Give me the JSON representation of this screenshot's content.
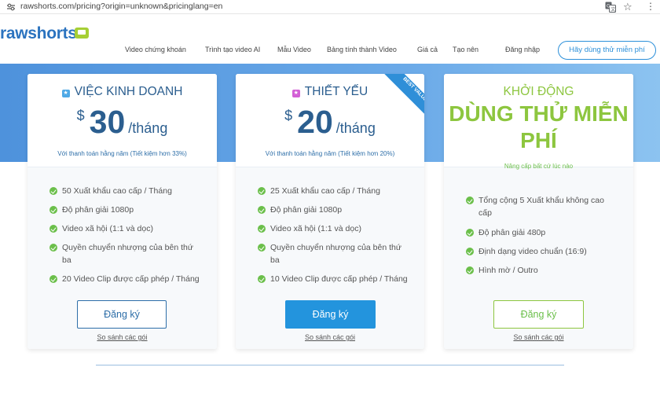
{
  "browser": {
    "url": "rawshorts.com/pricing?origin=unknown&pricinglang=en"
  },
  "nav": {
    "logo": "rawshorts",
    "links": [
      "Video chứng khoán",
      "Trình tạo video AI",
      "Mẫu Video",
      "Bảng tính thành Video",
      "Giá cả",
      "Tạo nên",
      "Đăng nhập"
    ],
    "cta": "Hãy dùng thử miễn phí"
  },
  "plans": [
    {
      "name": "VIỆC KINH DOANH",
      "currency": "$",
      "amount": "30",
      "period": "/tháng",
      "billing": "Với thanh toán hằng năm (Tiết kiệm hơn 33%)",
      "features": [
        "50 Xuất khẩu cao cấp / Tháng",
        "Độ phân giải 1080p",
        "Video xã hội (1:1 và dọc)",
        "Quyền chuyển nhượng của bên thứ ba",
        "20 Video Clip được cấp phép / Tháng"
      ],
      "button": "Đăng ký",
      "compare": "So sánh các gói"
    },
    {
      "name": "THIẾT YẾU",
      "badge": "BEST VALUE",
      "currency": "$",
      "amount": "20",
      "period": "/tháng",
      "billing": "Với thanh toán hằng năm (Tiết kiệm hơn 20%)",
      "features": [
        "25 Xuất khẩu cao cấp / Tháng",
        "Độ phân giải 1080p",
        "Video xã hội (1:1 và dọc)",
        "Quyền chuyển nhượng của bên thứ ba",
        "10 Video Clip được cấp phép / Tháng"
      ],
      "button": "Đăng ký",
      "compare": "So sánh các gói"
    },
    {
      "name": "KHỞI ĐỘNG",
      "headline_line1": "DÙNG THỬ MIỄN",
      "headline_line2": "PHÍ",
      "billing": "Nâng cấp bất cứ lúc nào",
      "features": [
        "Tổng cộng 5 Xuất khẩu không cao cấp",
        "Độ phân giải 480p",
        "Định dạng video chuẩn (16:9)",
        "Hình mờ / Outro"
      ],
      "button": "Đăng ký",
      "compare": "So sánh các gói"
    }
  ],
  "colors": {
    "brand_blue": "#2b73bf",
    "price_blue": "#2b5e8f",
    "check_green": "#6bbf4a",
    "free_green": "#8dc63f",
    "primary_button": "#2394dd",
    "band_start": "#4e92dc",
    "band_end": "#8cc3f0"
  }
}
